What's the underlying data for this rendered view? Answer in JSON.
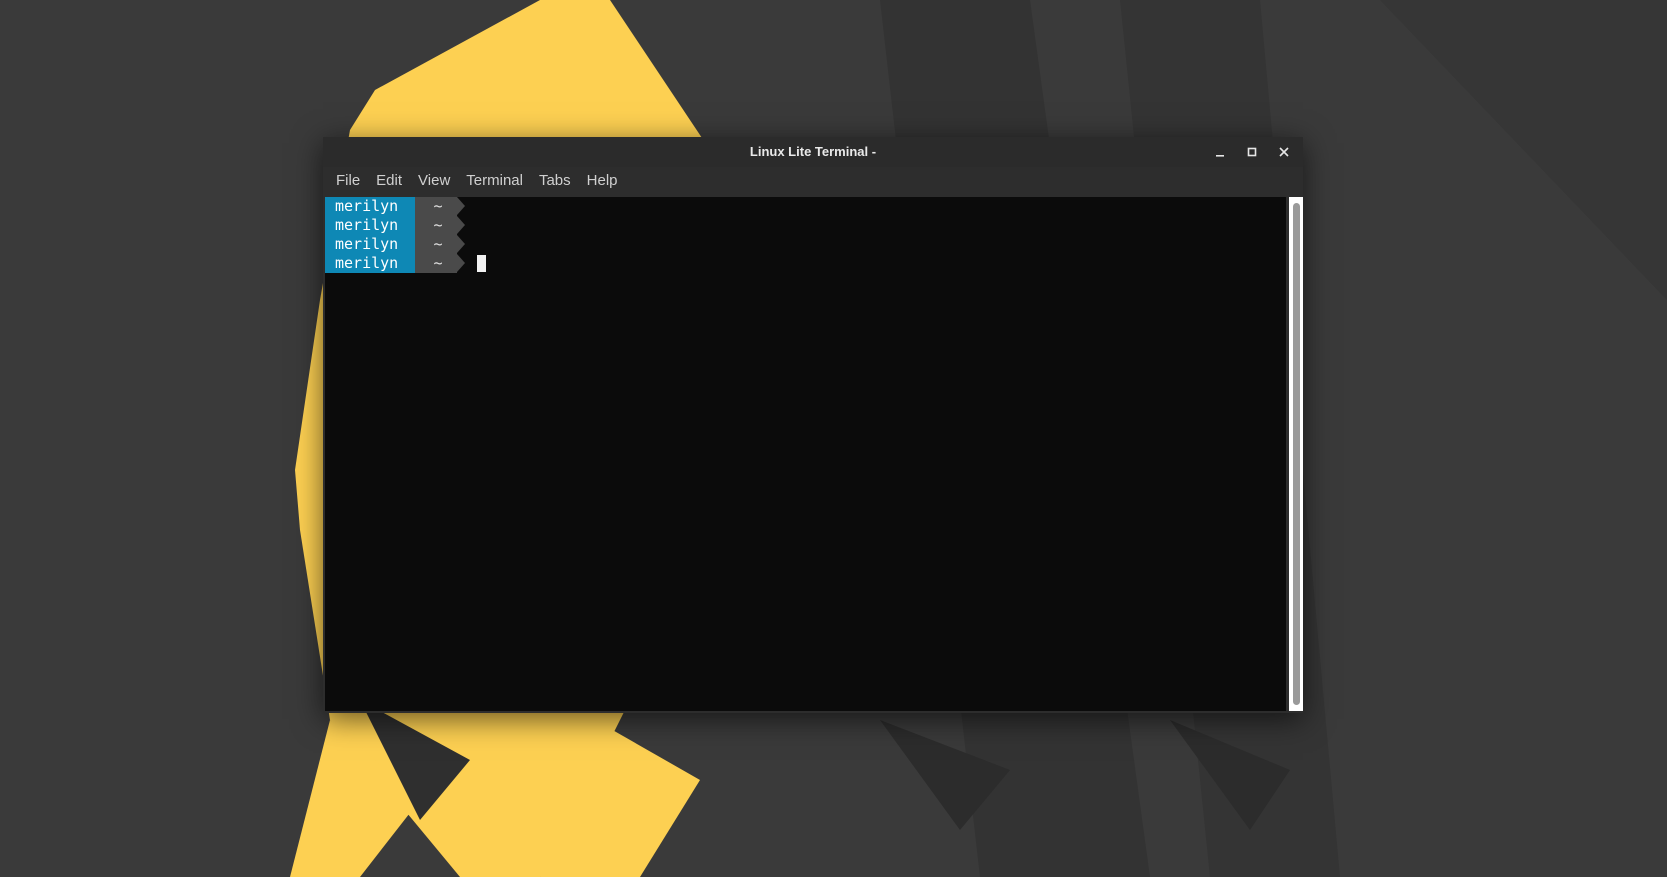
{
  "window": {
    "title": "Linux Lite Terminal -",
    "controls": {
      "minimize_icon": "minimize-icon",
      "maximize_icon": "maximize-icon",
      "close_icon": "close-icon"
    }
  },
  "menubar": {
    "items": [
      {
        "label": "File"
      },
      {
        "label": "Edit"
      },
      {
        "label": "View"
      },
      {
        "label": "Terminal"
      },
      {
        "label": "Tabs"
      },
      {
        "label": "Help"
      }
    ]
  },
  "terminal": {
    "prompts": [
      {
        "user": "merilyn",
        "dir": "~"
      },
      {
        "user": "merilyn",
        "dir": "~"
      },
      {
        "user": "merilyn",
        "dir": "~"
      },
      {
        "user": "merilyn",
        "dir": "~"
      }
    ]
  },
  "colors": {
    "prompt_user_bg": "#0e88b5",
    "prompt_dir_bg": "#4a4a4a",
    "wallpaper_accent": "#fdd052",
    "wallpaper_base": "#3a3a3a"
  }
}
